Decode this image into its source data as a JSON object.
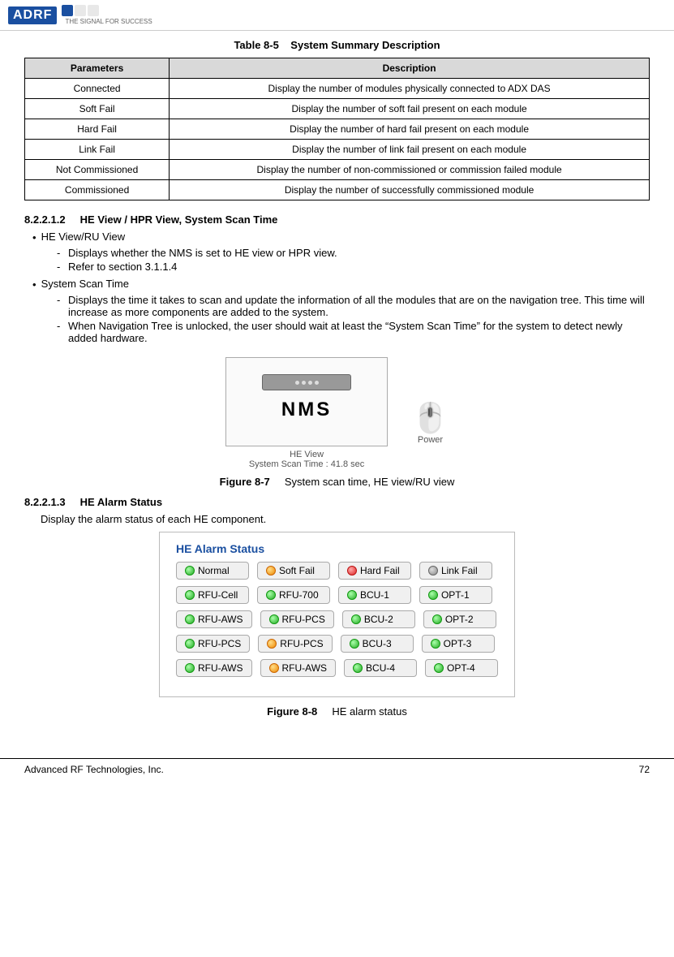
{
  "header": {
    "logo_text": "ADRF",
    "tagline": "THE SIGNAL FOR SUCCESS"
  },
  "table": {
    "title_label": "Table 8-5",
    "title_text": "System Summary Description",
    "col_parameters": "Parameters",
    "col_description": "Description",
    "rows": [
      {
        "param": "Connected",
        "desc": "Display the number of modules physically connected to ADX DAS"
      },
      {
        "param": "Soft Fail",
        "desc": "Display the number of soft fail present on each module"
      },
      {
        "param": "Hard Fail",
        "desc": "Display the number of hard fail present on each module"
      },
      {
        "param": "Link Fail",
        "desc": "Display the number of link fail present on each module"
      },
      {
        "param": "Not Commissioned",
        "desc": "Display the number of non-commissioned or commission failed module"
      },
      {
        "param": "Commissioned",
        "desc": "Display the number of successfully commissioned module"
      }
    ]
  },
  "section_822": {
    "number": "8.2.2.1.2",
    "title": "HE View / HPR View, System Scan Time"
  },
  "he_view_ru": {
    "label": "HE View/RU View",
    "dashes": [
      "Displays whether the NMS is set to HE view or HPR view.",
      "Refer to section 3.1.1.4"
    ]
  },
  "system_scan": {
    "label": "System Scan Time",
    "dashes": [
      "Displays the time it takes to scan and update the information of all the modules that are on the navigation tree.  This time will increase as more components are added to the system.",
      "When Navigation Tree is unlocked, the user should wait at least the “System Scan Time” for the system to detect newly added hardware."
    ]
  },
  "figure7": {
    "number": "Figure 8-7",
    "caption": "System scan time, HE view/RU view",
    "he_view_label": "HE View",
    "scan_time_label": "System Scan Time : 41.8 sec",
    "nms_label": "NMS",
    "power_label": "Power"
  },
  "section_823": {
    "number": "8.2.2.1.3",
    "title": "HE Alarm Status"
  },
  "alarm_status": {
    "intro": "Display the alarm status of each HE component.",
    "title": "HE Alarm Status",
    "status_row": [
      {
        "label": "Normal",
        "dot": "green"
      },
      {
        "label": "Soft Fail",
        "dot": "orange"
      },
      {
        "label": "Hard Fail",
        "dot": "red"
      },
      {
        "label": "Link Fail",
        "dot": "gray"
      }
    ],
    "component_rows": [
      [
        {
          "label": "RFU-Cell",
          "dot": "green"
        },
        {
          "label": "RFU-700",
          "dot": "green"
        },
        {
          "label": "BCU-1",
          "dot": "green"
        },
        {
          "label": "OPT-1",
          "dot": "green"
        }
      ],
      [
        {
          "label": "RFU-AWS",
          "dot": "green"
        },
        {
          "label": "RFU-PCS",
          "dot": "green"
        },
        {
          "label": "BCU-2",
          "dot": "green"
        },
        {
          "label": "OPT-2",
          "dot": "green"
        }
      ],
      [
        {
          "label": "RFU-PCS",
          "dot": "green"
        },
        {
          "label": "RFU-PCS",
          "dot": "orange"
        },
        {
          "label": "BCU-3",
          "dot": "green"
        },
        {
          "label": "OPT-3",
          "dot": "green"
        }
      ],
      [
        {
          "label": "RFU-AWS",
          "dot": "green"
        },
        {
          "label": "RFU-AWS",
          "dot": "orange"
        },
        {
          "label": "BCU-4",
          "dot": "green"
        },
        {
          "label": "OPT-4",
          "dot": "green"
        }
      ]
    ]
  },
  "figure8": {
    "number": "Figure 8-8",
    "caption": "HE alarm status"
  },
  "footer": {
    "company": "Advanced RF Technologies, Inc.",
    "page": "72"
  }
}
